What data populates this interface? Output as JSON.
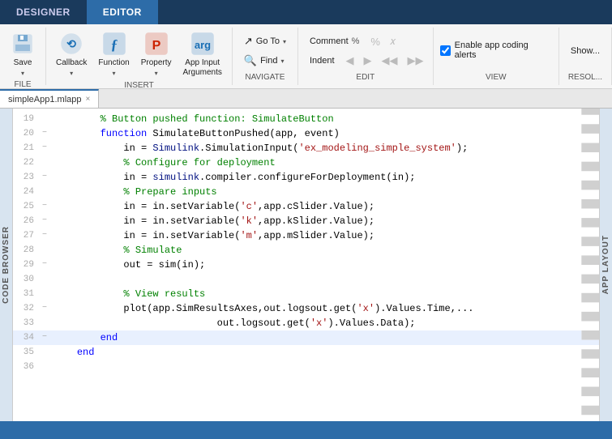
{
  "tabs": [
    {
      "id": "designer",
      "label": "DESIGNER",
      "active": false
    },
    {
      "id": "editor",
      "label": "EDITOR",
      "active": true
    }
  ],
  "ribbon": {
    "groups": [
      {
        "id": "file",
        "label": "FILE",
        "buttons": [
          {
            "id": "save",
            "label": "Save",
            "icon": "💾",
            "hasArrow": true
          }
        ]
      },
      {
        "id": "insert",
        "label": "INSERT",
        "buttons": [
          {
            "id": "callback",
            "label": "Callback",
            "icon": "🔵",
            "hasArrow": true
          },
          {
            "id": "function",
            "label": "Function",
            "icon": "ƒ",
            "hasArrow": true
          },
          {
            "id": "property",
            "label": "Property",
            "icon": "P",
            "hasArrow": true
          },
          {
            "id": "app-input-args",
            "label": "App Input\nArguments",
            "icon": "⬛",
            "hasArrow": false
          }
        ]
      }
    ],
    "navigate": {
      "label": "NAVIGATE",
      "goto_label": "Go To",
      "goto_arrow": "▾",
      "find_label": "Find",
      "find_arrow": "▾"
    },
    "edit": {
      "label": "EDIT",
      "comment_label": "Comment",
      "comment_pct": "%",
      "indent_label": "Indent",
      "icons": [
        "◀",
        "▶",
        "◀◀",
        "▶▶"
      ]
    },
    "view": {
      "label": "VIEW",
      "checkbox_label": "Enable app coding alerts",
      "checked": true
    },
    "resolve": {
      "label": "RESOL...",
      "show_label": "Show..."
    }
  },
  "file_tab": {
    "name": "simpleApp1.mlapp",
    "close": "×"
  },
  "side_labels": {
    "code_browser": "CODE BROWSER",
    "app_layout": "APP LAYOUT"
  },
  "code": {
    "lines": [
      {
        "num": "19",
        "fold": "",
        "content": "        % Button pushed function: SimulateButton",
        "type": "comment",
        "highlighted": false
      },
      {
        "num": "20",
        "fold": "−",
        "content": "        function SimulateButtonPushed(app, event)",
        "type": "mixed",
        "highlighted": false
      },
      {
        "num": "21",
        "fold": "−",
        "content": "            in = Simulink.SimulationInput('ex_modeling_simple_system');",
        "type": "mixed",
        "highlighted": false
      },
      {
        "num": "22",
        "fold": "",
        "content": "            % Configure for deployment",
        "type": "comment",
        "highlighted": false
      },
      {
        "num": "23",
        "fold": "−",
        "content": "            in = simulink.compiler.configureForDeployment(in);",
        "type": "mixed",
        "highlighted": false
      },
      {
        "num": "24",
        "fold": "",
        "content": "            % Prepare inputs",
        "type": "comment",
        "highlighted": false
      },
      {
        "num": "25",
        "fold": "−",
        "content": "            in = in.setVariable('c',app.cSlider.Value);",
        "type": "mixed",
        "highlighted": false
      },
      {
        "num": "26",
        "fold": "−",
        "content": "            in = in.setVariable('k',app.kSlider.Value);",
        "type": "mixed",
        "highlighted": false
      },
      {
        "num": "27",
        "fold": "−",
        "content": "            in = in.setVariable('m',app.mSlider.Value);",
        "type": "mixed",
        "highlighted": false
      },
      {
        "num": "28",
        "fold": "",
        "content": "            % Simulate",
        "type": "comment",
        "highlighted": false
      },
      {
        "num": "29",
        "fold": "−",
        "content": "            out = sim(in);",
        "type": "mixed",
        "highlighted": false
      },
      {
        "num": "30",
        "fold": "",
        "content": "",
        "type": "normal",
        "highlighted": false
      },
      {
        "num": "31",
        "fold": "",
        "content": "            % View results",
        "type": "comment",
        "highlighted": false
      },
      {
        "num": "32",
        "fold": "−",
        "content": "            plot(app.SimResultsAxes,out.logsout.get('x').Values.Time,...",
        "type": "mixed",
        "highlighted": false
      },
      {
        "num": "33",
        "fold": "",
        "content": "                            out.logsout.get('x').Values.Data);",
        "type": "mixed",
        "highlighted": false
      },
      {
        "num": "34",
        "fold": "−",
        "content": "        end",
        "type": "keyword",
        "highlighted": true
      },
      {
        "num": "35",
        "fold": "",
        "content": "    end",
        "type": "keyword",
        "highlighted": false
      },
      {
        "num": "36",
        "fold": "",
        "content": "",
        "type": "normal",
        "highlighted": false
      }
    ]
  }
}
